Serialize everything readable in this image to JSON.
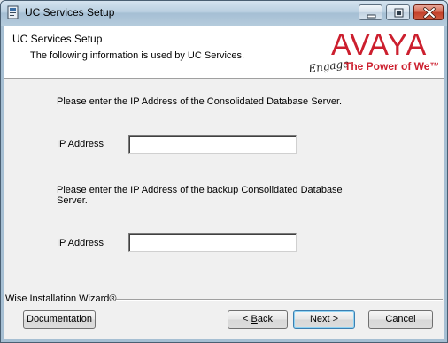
{
  "window": {
    "title": "UC Services Setup"
  },
  "header": {
    "title": "UC Services Setup",
    "subtitle": "The following information is used by UC Services."
  },
  "logo": {
    "brand": "AVAYA",
    "tagline_script": "Engage",
    "tagline": "The Power of We™",
    "brand_color": "#cc1f2e"
  },
  "form": {
    "primary_prompt": "Please enter the IP Address of the Consolidated Database Server.",
    "primary_label": "IP Address",
    "primary_value": "",
    "backup_prompt_line1": "Please enter the IP Address of the backup Consolidated Database",
    "backup_prompt_line2": "Server.",
    "backup_label": "IP Address",
    "backup_value": ""
  },
  "footer": {
    "brand": "Wise Installation Wizard®",
    "documentation": "Documentation",
    "back_prefix": "< ",
    "back_accel": "B",
    "back_rest": "ack",
    "next": "Next >",
    "cancel": "Cancel"
  }
}
